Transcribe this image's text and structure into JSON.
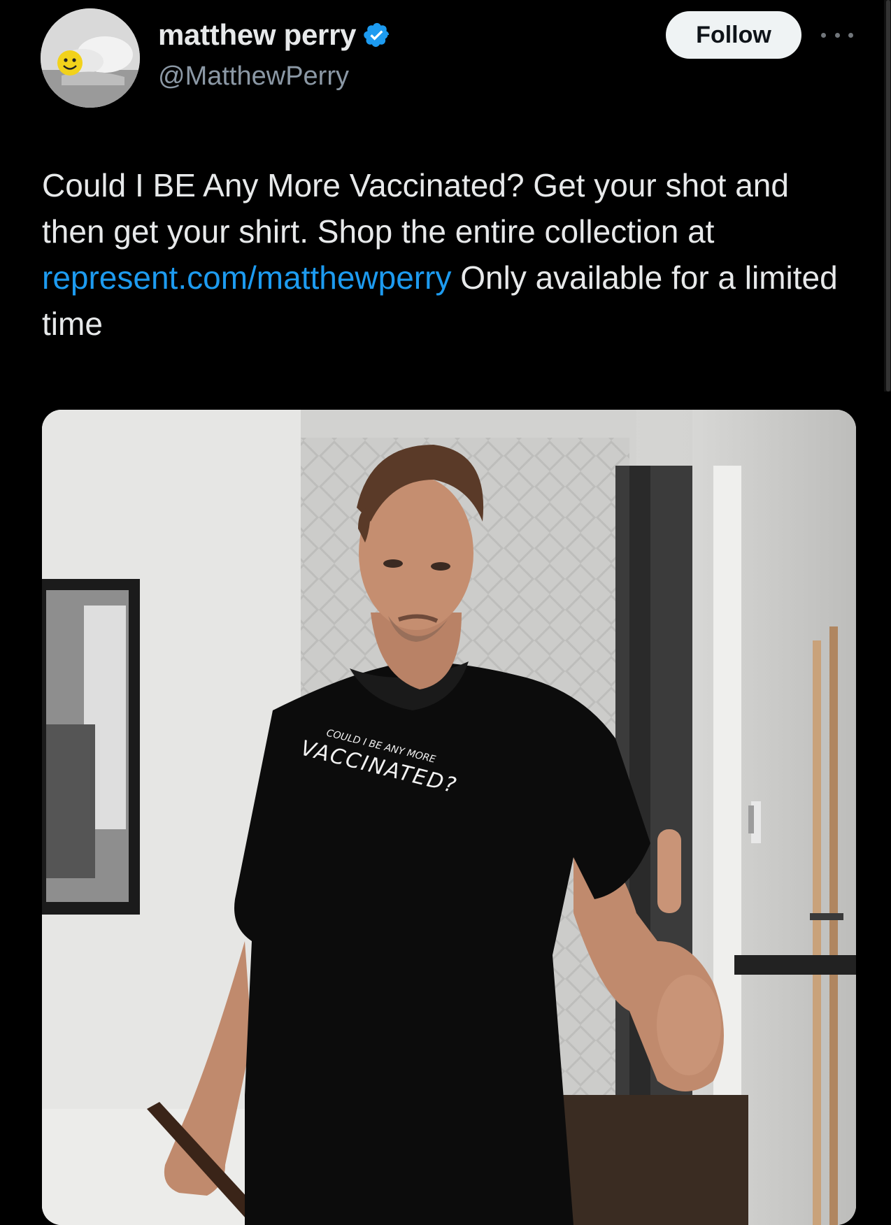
{
  "user": {
    "display_name": "matthew perry",
    "handle": "@MatthewPerry",
    "verified": true,
    "verified_color": "#1d9bf0"
  },
  "actions": {
    "follow_label": "Follow",
    "more_icon": "more-horizontal-icon"
  },
  "tweet": {
    "text_before_link": "Could I BE Any More Vaccinated? Get your shot and then get your shirt. Shop the entire collection at ",
    "link_text": "represent.com/matthewperry",
    "text_after_link": " Only available for a limited time"
  },
  "media": {
    "shirt_line_1": "COULD I BE ANY MORE",
    "shirt_line_2": "VACCINATED?"
  },
  "colors": {
    "background": "#000000",
    "text": "#e7e9ea",
    "secondary_text": "#8b98a5",
    "link": "#1d9bf0",
    "follow_button_bg": "#eff3f4"
  }
}
